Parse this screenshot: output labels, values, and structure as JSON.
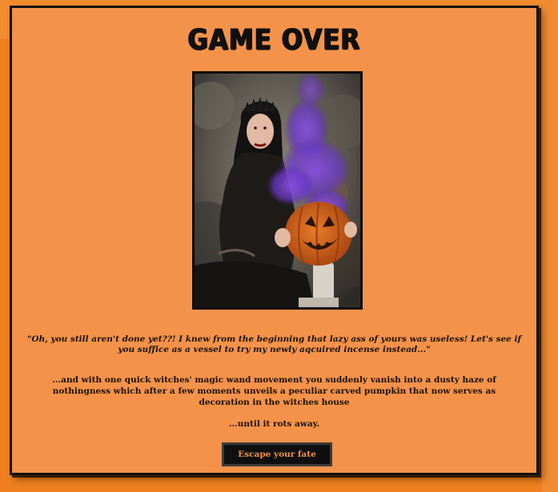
{
  "screen": {
    "title": "GAME OVER"
  },
  "image": {
    "description_icon": "witch-with-smoking-pumpkin-photo"
  },
  "story": {
    "quote": "\"Oh, you still aren't done yet??! I knew from the beginning that lazy ass of yours was useless! Let's see if you suffice as a vessel to try my newly aqcuired incense instead...\"",
    "narration": "...and with one quick witches' magic wand movement you suddenly vanish into a dusty haze of nothingness which after a few moments unveils a peculiar carved pumpkin that now serves as decoration in the witches house",
    "ending": "...until it rots away."
  },
  "actions": {
    "escape_label": "Escape your fate"
  },
  "colors": {
    "page_background": "#ef7f1e",
    "panel_background": "#f4924a",
    "button_background": "#0f0f0f",
    "button_text": "#f4924a"
  }
}
